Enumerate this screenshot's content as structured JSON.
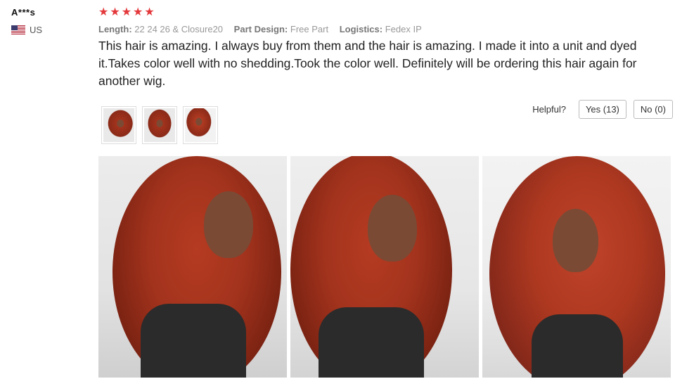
{
  "user": {
    "name": "A***s",
    "country": "US",
    "flag_icon": "us-flag-icon"
  },
  "review": {
    "rating": 5,
    "rating_max": 5,
    "meta": [
      {
        "label": "Length:",
        "value": "22 24 26 & Closure20"
      },
      {
        "label": "Part Design:",
        "value": "Free Part"
      },
      {
        "label": "Logistics:",
        "value": "Fedex IP"
      }
    ],
    "text": "This hair is amazing. I always buy from them and the hair is amazing. I made it into a unit and dyed it.Takes color well with no shedding.Took the color well. Definitely will be ordering this hair again for another wig."
  },
  "helpful": {
    "label": "Helpful?",
    "yes_label": "Yes (13)",
    "no_label": "No (0)"
  },
  "colors": {
    "star": "#e4393c",
    "hair": "#a3331d",
    "hair_dark": "#7a2212",
    "skin": "#7a4a35",
    "wall": "#e9e9e9"
  }
}
